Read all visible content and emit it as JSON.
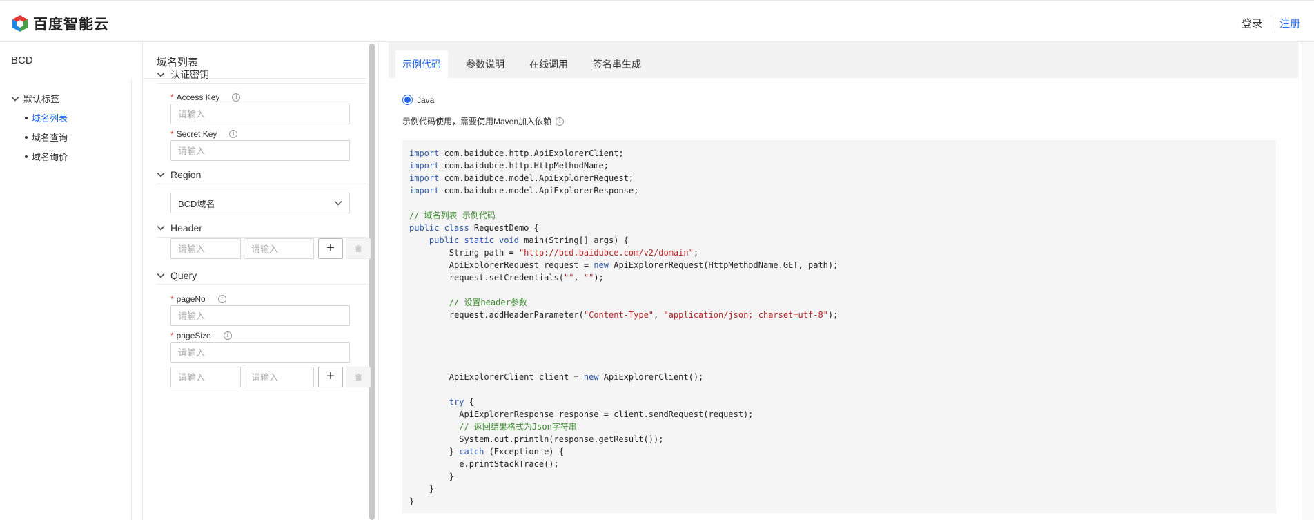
{
  "header": {
    "brand": "百度智能云",
    "login": "登录",
    "register": "注册"
  },
  "nav": {
    "title": "BCD",
    "group": "默认标签",
    "items": [
      "域名列表",
      "域名查询",
      "域名询价"
    ],
    "active_index": 0
  },
  "form": {
    "title": "域名列表",
    "auth": {
      "heading": "认证密钥",
      "access_key_label": "Access Key",
      "secret_key_label": "Secret Key",
      "placeholder": "请输入"
    },
    "region": {
      "heading": "Region",
      "selected": "BCD域名"
    },
    "header_section": {
      "heading": "Header",
      "key_placeholder": "请输入",
      "value_placeholder": "请输入"
    },
    "query": {
      "heading": "Query",
      "page_no_label": "pageNo",
      "page_size_label": "pageSize",
      "placeholder": "请输入",
      "key_placeholder": "请输入",
      "value_placeholder": "请输入"
    },
    "required_mark": "*",
    "info_glyph": "i"
  },
  "main": {
    "tabs": [
      "示例代码",
      "参数说明",
      "在线调用",
      "签名串生成"
    ],
    "active_tab": 0,
    "language": "Java",
    "description": "示例代码使用，需要使用Maven加入依赖",
    "code_lines": [
      [
        [
          "kw",
          "import"
        ],
        [
          "t",
          " com.baidubce.http.ApiExplorerClient;"
        ]
      ],
      [
        [
          "kw",
          "import"
        ],
        [
          "t",
          " com.baidubce.http.HttpMethodName;"
        ]
      ],
      [
        [
          "kw",
          "import"
        ],
        [
          "t",
          " com.baidubce.model.ApiExplorerRequest;"
        ]
      ],
      [
        [
          "kw",
          "import"
        ],
        [
          "t",
          " com.baidubce.model.ApiExplorerResponse;"
        ]
      ],
      [],
      [
        [
          "cm",
          "// 域名列表 示例代码"
        ]
      ],
      [
        [
          "kw",
          "public class"
        ],
        [
          "t",
          " RequestDemo {"
        ]
      ],
      [
        [
          "t",
          "    "
        ],
        [
          "kw",
          "public static void"
        ],
        [
          "t",
          " main(String[] args) {"
        ]
      ],
      [
        [
          "t",
          "        String path = "
        ],
        [
          "str",
          "\"http://bcd.baidubce.com/v2/domain\""
        ],
        [
          "t",
          ";"
        ]
      ],
      [
        [
          "t",
          "        ApiExplorerRequest request = "
        ],
        [
          "kw",
          "new"
        ],
        [
          "t",
          " ApiExplorerRequest(HttpMethodName.GET, path);"
        ]
      ],
      [
        [
          "t",
          "        request.setCredentials("
        ],
        [
          "str",
          "\"\""
        ],
        [
          "t",
          ", "
        ],
        [
          "str",
          "\"\""
        ],
        [
          "t",
          ");"
        ]
      ],
      [],
      [
        [
          "t",
          "        "
        ],
        [
          "cm",
          "// 设置header参数"
        ]
      ],
      [
        [
          "t",
          "        request.addHeaderParameter("
        ],
        [
          "str",
          "\"Content-Type\""
        ],
        [
          "t",
          ", "
        ],
        [
          "str",
          "\"application/json; charset=utf-8\""
        ],
        [
          "t",
          ");"
        ]
      ],
      [],
      [],
      [],
      [],
      [
        [
          "t",
          "        ApiExplorerClient client = "
        ],
        [
          "kw",
          "new"
        ],
        [
          "t",
          " ApiExplorerClient();"
        ]
      ],
      [],
      [
        [
          "t",
          "        "
        ],
        [
          "kw",
          "try"
        ],
        [
          "t",
          " {"
        ]
      ],
      [
        [
          "t",
          "          ApiExplorerResponse response = client.sendRequest(request);"
        ]
      ],
      [
        [
          "t",
          "          "
        ],
        [
          "cm",
          "// 返回结果格式为Json字符串"
        ]
      ],
      [
        [
          "t",
          "          System.out.println(response.getResult());"
        ]
      ],
      [
        [
          "t",
          "        } "
        ],
        [
          "kw",
          "catch"
        ],
        [
          "t",
          " (Exception e) {"
        ]
      ],
      [
        [
          "t",
          "          e.printStackTrace();"
        ]
      ],
      [
        [
          "t",
          "        }"
        ]
      ],
      [
        [
          "t",
          "    }"
        ]
      ],
      [
        [
          "t",
          "}"
        ]
      ]
    ]
  },
  "colors": {
    "accent": "#2468f2",
    "required": "#ee4433",
    "keyword": "#2a55a8",
    "string": "#b22222",
    "comment": "#3c8a2e"
  }
}
